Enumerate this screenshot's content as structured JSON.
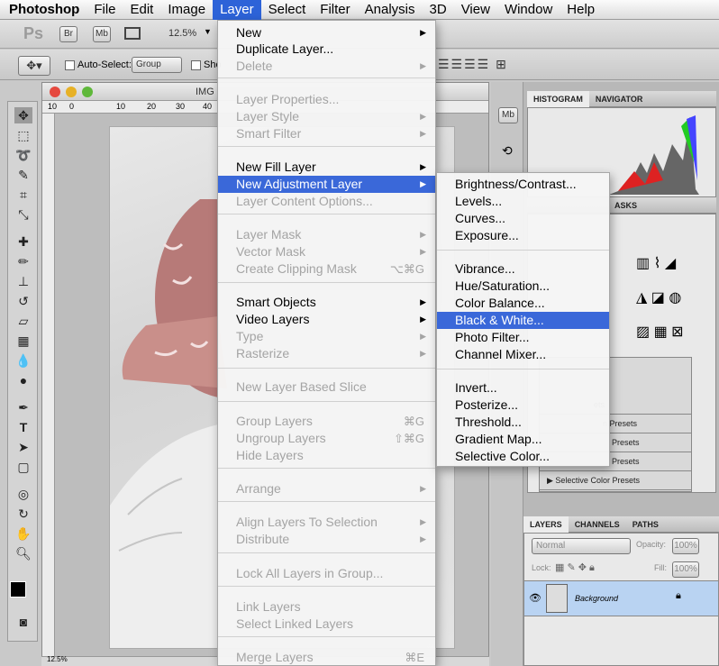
{
  "menubar": {
    "app": "Photoshop",
    "items": [
      "File",
      "Edit",
      "Image",
      "Layer",
      "Select",
      "Filter",
      "Analysis",
      "3D",
      "View",
      "Window",
      "Help"
    ],
    "active": "Layer"
  },
  "appbar": {
    "logo": "Ps",
    "bridge": "Br",
    "minibridge": "Mb",
    "zoom": "12.5%"
  },
  "options": {
    "auto_select_label": "Auto-Select:",
    "auto_select_value": "Group",
    "show_label": "Sho"
  },
  "document": {
    "title": "IMG",
    "ruler_marks": [
      "10",
      "0",
      "10",
      "20",
      "30",
      "40"
    ]
  },
  "layer_menu": {
    "items": [
      {
        "label": "New",
        "arrow": true,
        "disabled": false
      },
      {
        "label": "Duplicate Layer...",
        "disabled": false
      },
      {
        "label": "Delete",
        "arrow": true,
        "disabled": true
      },
      {
        "label": "Layer Properties...",
        "disabled": true
      },
      {
        "label": "Layer Style",
        "arrow": true,
        "disabled": true
      },
      {
        "label": "Smart Filter",
        "arrow": true,
        "disabled": true
      },
      {
        "label": "New Fill Layer",
        "arrow": true,
        "disabled": false
      },
      {
        "label": "New Adjustment Layer",
        "arrow": true,
        "disabled": false,
        "highlighted": true
      },
      {
        "label": "Layer Content Options...",
        "disabled": true
      },
      {
        "label": "Layer Mask",
        "arrow": true,
        "disabled": true
      },
      {
        "label": "Vector Mask",
        "arrow": true,
        "disabled": true
      },
      {
        "label": "Create Clipping Mask",
        "shortcut": "⌥⌘G",
        "disabled": true
      },
      {
        "label": "Smart Objects",
        "arrow": true,
        "disabled": false
      },
      {
        "label": "Video Layers",
        "arrow": true,
        "disabled": false
      },
      {
        "label": "Type",
        "arrow": true,
        "disabled": true
      },
      {
        "label": "Rasterize",
        "arrow": true,
        "disabled": true
      },
      {
        "label": "New Layer Based Slice",
        "disabled": true
      },
      {
        "label": "Group Layers",
        "shortcut": "⌘G",
        "disabled": true
      },
      {
        "label": "Ungroup Layers",
        "shortcut": "⇧⌘G",
        "disabled": true
      },
      {
        "label": "Hide Layers",
        "disabled": true
      },
      {
        "label": "Arrange",
        "arrow": true,
        "disabled": true
      },
      {
        "label": "Align Layers To Selection",
        "arrow": true,
        "disabled": true
      },
      {
        "label": "Distribute",
        "arrow": true,
        "disabled": true
      },
      {
        "label": "Lock All Layers in Group...",
        "disabled": true
      },
      {
        "label": "Link Layers",
        "disabled": true
      },
      {
        "label": "Select Linked Layers",
        "disabled": true
      },
      {
        "label": "Merge Layers",
        "shortcut": "⌘E",
        "disabled": true
      }
    ]
  },
  "adjustment_submenu": {
    "items": [
      {
        "label": "Brightness/Contrast..."
      },
      {
        "label": "Levels..."
      },
      {
        "label": "Curves..."
      },
      {
        "label": "Exposure..."
      },
      {
        "label": "Vibrance..."
      },
      {
        "label": "Hue/Saturation..."
      },
      {
        "label": "Color Balance..."
      },
      {
        "label": "Black & White...",
        "highlighted": true
      },
      {
        "label": "Photo Filter..."
      },
      {
        "label": "Channel Mixer..."
      },
      {
        "label": "Invert..."
      },
      {
        "label": "Posterize..."
      },
      {
        "label": "Threshold..."
      },
      {
        "label": "Gradient Map..."
      },
      {
        "label": "Selective Color..."
      }
    ]
  },
  "panels": {
    "top_tabs": [
      "HISTOGRAM",
      "NAVIGATOR"
    ],
    "masks_tab": "ASKS",
    "presets": [
      "ets",
      "n Presets",
      "Presets",
      "Presets",
      "Selective Color Presets"
    ],
    "layers_tabs": [
      "LAYERS",
      "CHANNELS",
      "PATHS"
    ],
    "blend_mode": "Normal",
    "opacity_label": "Opacity:",
    "opacity_value": "100%",
    "lock_label": "Lock:",
    "fill_label": "Fill:",
    "fill_value": "100%",
    "layer_name": "Background"
  },
  "status": {
    "zoom": "12.5%"
  },
  "colors": {
    "menu_highlight": "#3a68d9",
    "menubar_active": "#2d63d8"
  }
}
